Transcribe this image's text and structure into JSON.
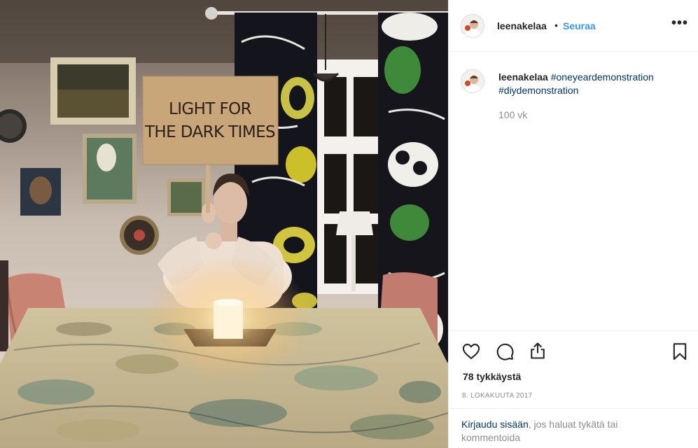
{
  "photo": {
    "sign_line1": "LIGHT FOR",
    "sign_line2": "THE DARK TIMES"
  },
  "header": {
    "username": "leenakelaa",
    "separator": "•",
    "follow_label": "Seuraa",
    "more_icon": "ellipsis-icon",
    "more_label": "•••"
  },
  "caption": {
    "username": "leenakelaa",
    "hashtags": [
      "#oneyeardemonstration",
      "#diydemonstration"
    ],
    "time_ago": "100 vk"
  },
  "actions": {
    "icons": [
      "heart-icon",
      "comment-icon",
      "share-icon",
      "bookmark-icon"
    ],
    "likes": "78 tykkäystä",
    "date": "8. LOKAKUUTA 2017"
  },
  "login": {
    "link_text": "Kirjaudu sisään",
    "rest_text": ", jos haluat tykätä tai kommentoida"
  },
  "colors": {
    "link": "#3897f0",
    "hashtag": "#003569",
    "muted": "#8e8e8e",
    "border": "#efefef"
  }
}
